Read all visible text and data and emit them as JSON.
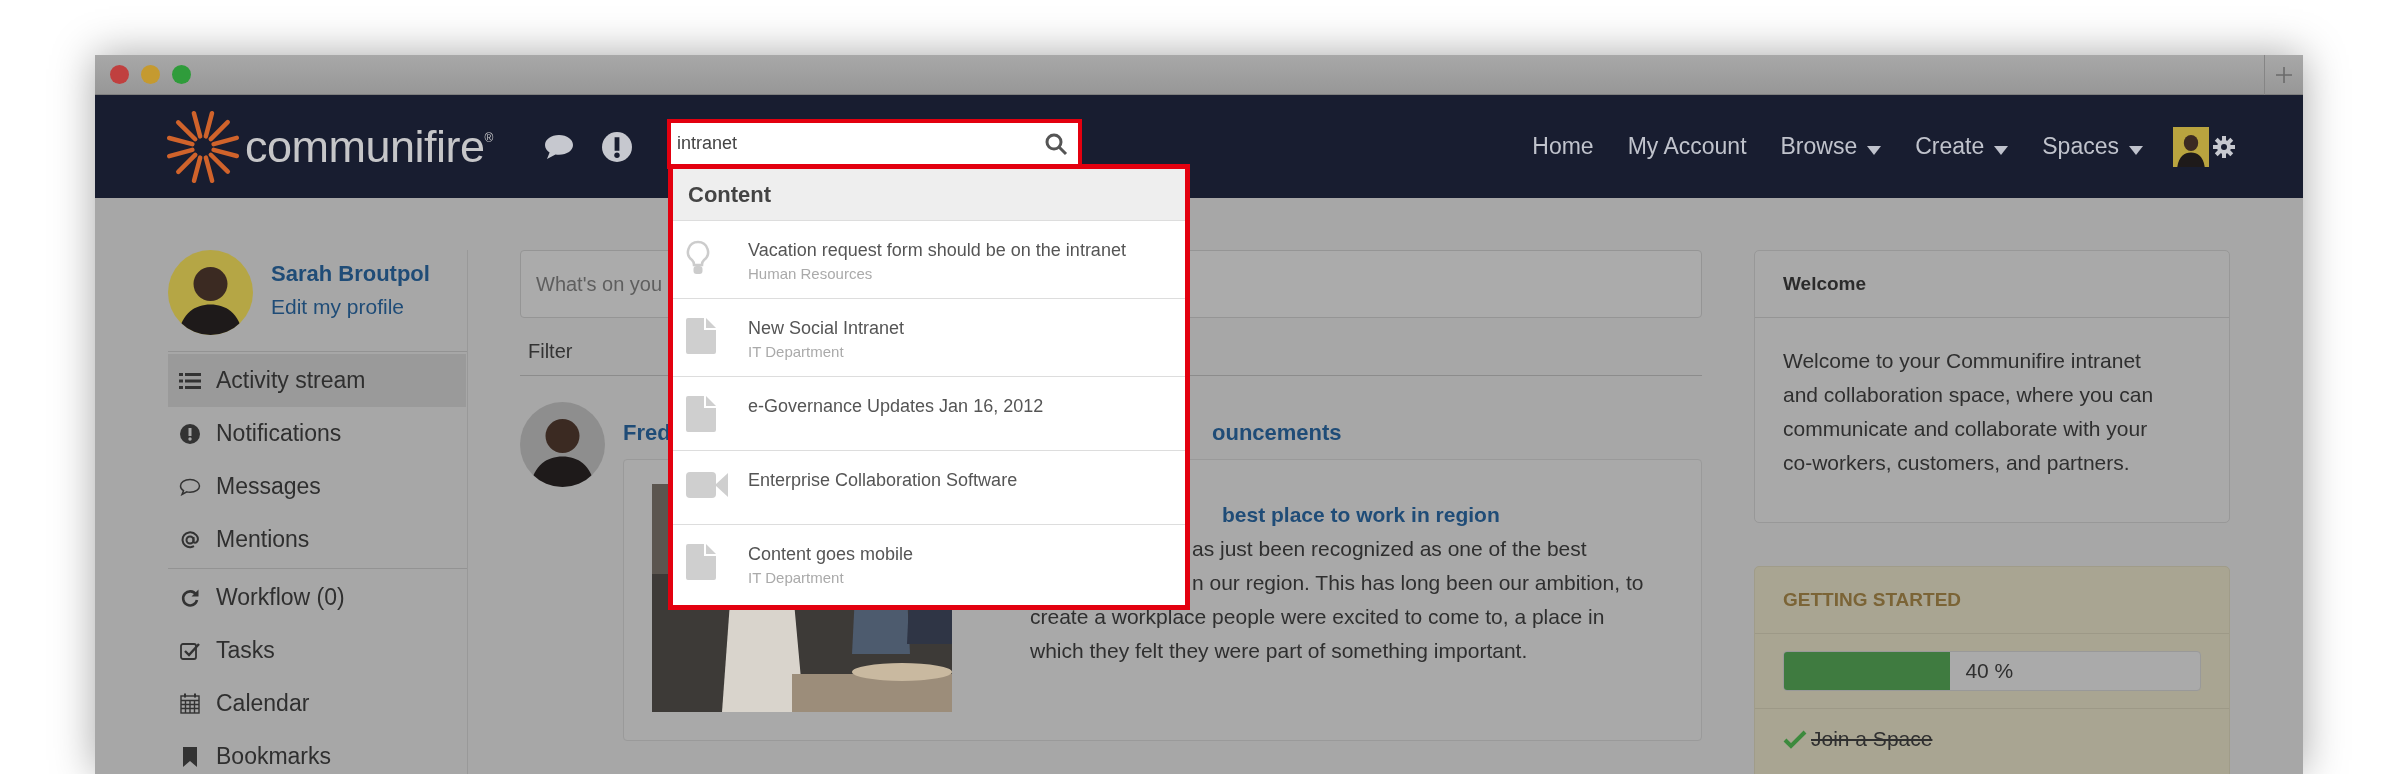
{
  "brand": {
    "name": "communifire$^{®}$"
  },
  "search": {
    "value": "intranet"
  },
  "search_results": {
    "heading": "Content",
    "items": [
      {
        "kind": "idea",
        "title": "Vacation request form should be on the intranet",
        "subtitle": "Human Resources"
      },
      {
        "kind": "document",
        "title": "New Social Intranet",
        "subtitle": "IT Department"
      },
      {
        "kind": "document",
        "title": "e-Governance Updates Jan 16, 2012"
      },
      {
        "kind": "video",
        "title": "Enterprise Collaboration Software"
      },
      {
        "kind": "document",
        "title": "Content goes mobile",
        "subtitle": "IT Department"
      }
    ]
  },
  "nav": [
    {
      "label": "Home",
      "has_menu": false
    },
    {
      "label": "My Account",
      "has_menu": false
    },
    {
      "label": "Browse",
      "has_menu": true
    },
    {
      "label": "Create",
      "has_menu": true
    },
    {
      "label": "Spaces",
      "has_menu": true
    }
  ],
  "profile": {
    "name": "Sarah Broutpol",
    "link": "Edit my profile"
  },
  "sidebar": {
    "groups": [
      {
        "items": [
          {
            "label": "Activity stream",
            "selected": true
          },
          {
            "label": "Notifications",
            "selected": false
          },
          {
            "label": "Messages",
            "selected": false
          },
          {
            "label": "Mentions",
            "selected": false
          }
        ]
      },
      {
        "items": [
          {
            "label": "Workflow (0)",
            "selected": false
          },
          {
            "label": "Tasks",
            "selected": false
          },
          {
            "label": "Calendar",
            "selected": false
          },
          {
            "label": "Bookmarks",
            "selected": false
          }
        ]
      }
    ]
  },
  "composer": {
    "placeholder": "What's on you"
  },
  "filter": "Filter",
  "post": {
    "author": "Fred",
    "title_rest": "ouncements",
    "headline": "best place to work in region",
    "body_lines": [
      "as just been recognized as one of the best",
      "n our region. This has long been our ambition, to",
      "create a workplace people were excited to come to, a place in",
      "which they felt they were part of something important."
    ]
  },
  "welcome": {
    "title": "Welcome",
    "text": "Welcome to your Communifire intranet and collaboration space, where you can communicate and collaborate with your co-workers, customers, and partners."
  },
  "getting_started": {
    "title": "GETTING STARTED",
    "progress": {
      "level": 0.4,
      "reading": "40 %"
    },
    "tasks": [
      {
        "label": "Join a Space",
        "done": true
      }
    ]
  }
}
